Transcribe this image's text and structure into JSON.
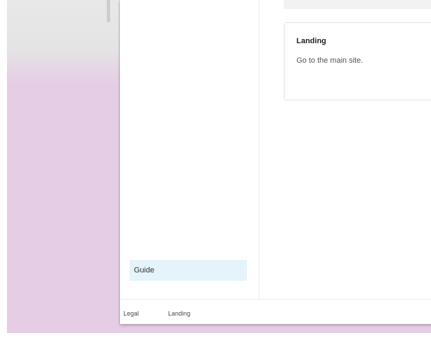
{
  "sidebar": {
    "items": [
      {
        "label": "Guide",
        "selected": true
      }
    ]
  },
  "main": {
    "cards": [
      {
        "title": "Landing",
        "description": "Go to the main site."
      }
    ]
  },
  "footer": {
    "links": [
      {
        "label": "Legal"
      },
      {
        "label": "Landing"
      }
    ]
  },
  "colors": {
    "desktop_background": "#e6cde6",
    "desktop_top": "#e8e8e8",
    "selected_item_background": "#e5f3fb",
    "card_border": "#e3e3e3"
  }
}
